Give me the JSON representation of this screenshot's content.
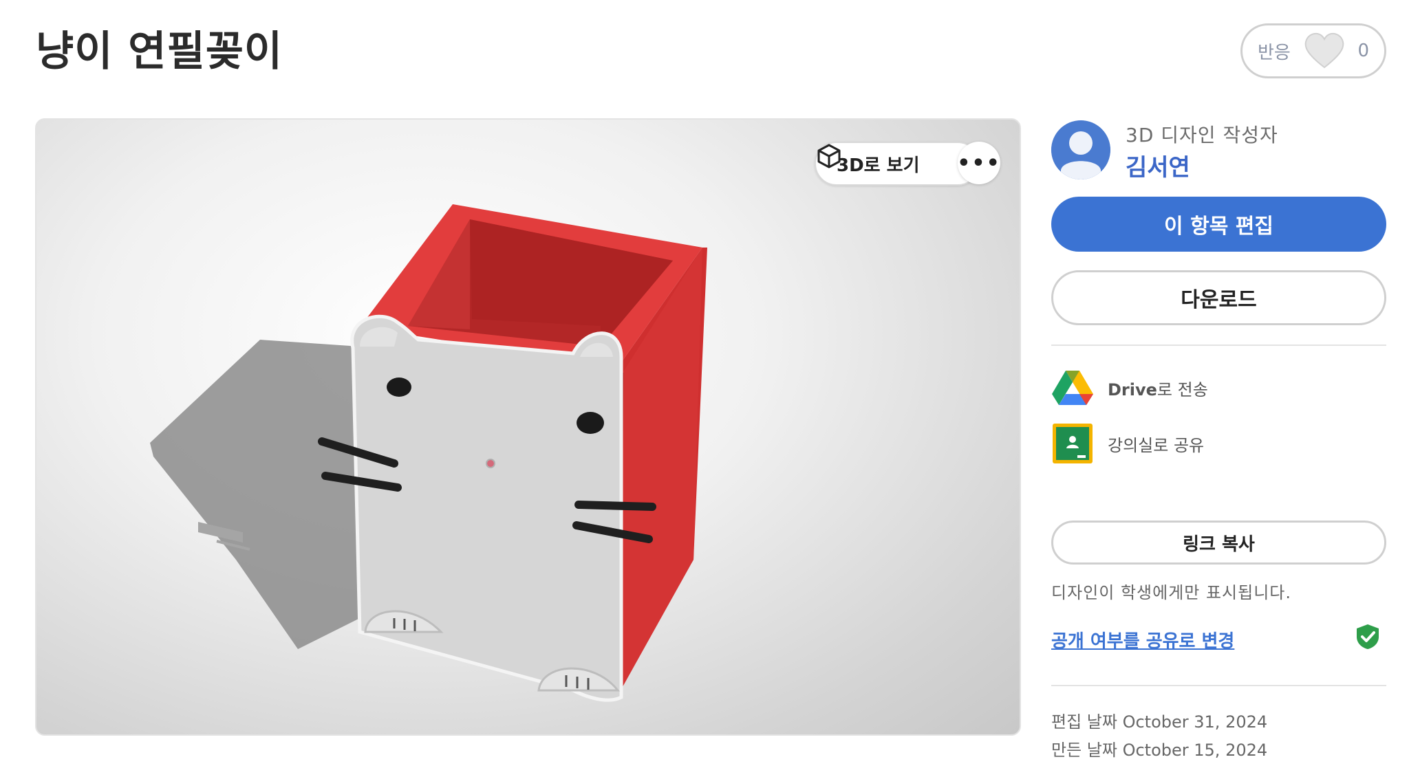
{
  "page": {
    "title": "냥이 연필꽂이"
  },
  "reactions": {
    "label": "반응",
    "count": "0"
  },
  "viewer": {
    "view_3d_label": "3D로 보기",
    "more_label": "•••"
  },
  "author": {
    "role": "3D 디자인 작성자",
    "name": "김서연"
  },
  "actions": {
    "edit_label": "이 항목 편집",
    "download_label": "다운로드",
    "drive_label_bold": "Drive",
    "drive_label_rest": "로 전송",
    "classroom_label": "강의실로 공유",
    "copy_link_label": "링크 복사"
  },
  "sharing": {
    "visibility_note": "디자인이 학생에게만 표시됩니다.",
    "change_link": "공개 여부를 공유로 변경"
  },
  "dates": {
    "edited_label": "편집 날짜",
    "edited_value": "October 31, 2024",
    "created_label": "만든 날짜",
    "created_value": "October 15, 2024"
  },
  "colors": {
    "accent": "#3b73d3",
    "box_red": "#d93a3a",
    "shield_green": "#2e9e4a"
  }
}
